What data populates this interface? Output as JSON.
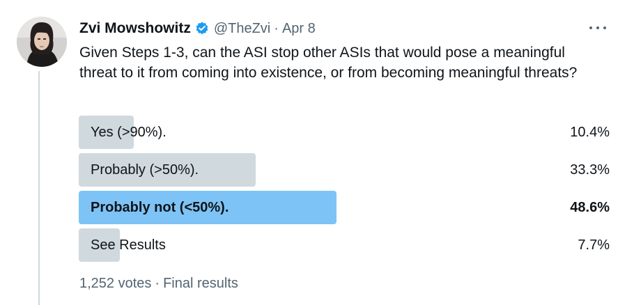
{
  "author": {
    "display_name": "Zvi Mowshowitz",
    "handle": "@TheZvi",
    "separator": "·",
    "date": "Apr 8",
    "verified_icon": "verified-badge-icon",
    "verified_color": "#1d9bf0"
  },
  "tweet": {
    "text": "Given Steps 1-3, can the ASI stop other ASIs that would pose a meaningful threat to it from coming into existence, or from becoming meaningful threats?"
  },
  "poll": {
    "options": [
      {
        "label": "Yes (>90%).",
        "percent": "10.4%",
        "share": 0.104,
        "winner": false
      },
      {
        "label": "Probably (>50%).",
        "percent": "33.3%",
        "share": 0.333,
        "winner": false
      },
      {
        "label": "Probably not (<50%).",
        "percent": "48.6%",
        "share": 0.486,
        "winner": true
      },
      {
        "label": "See Results",
        "percent": "7.7%",
        "share": 0.077,
        "winner": false
      }
    ],
    "votes": "1,252 votes",
    "separator": "·",
    "status": "Final results",
    "bar_color": "#cfd9de",
    "winner_color": "#7ec3f5"
  },
  "more_icon": "more-horizontal-icon"
}
